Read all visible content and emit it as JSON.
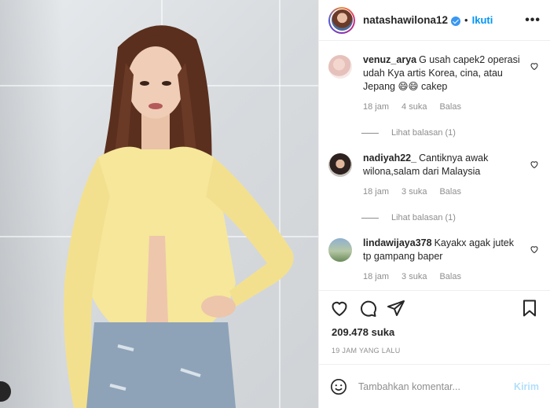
{
  "post_header": {
    "username": "natashawilona12",
    "separator": "•",
    "follow_label": "Ikuti",
    "more_label": "•••"
  },
  "comments": [
    {
      "username": "venuz_arya",
      "text": "G usah capek2 operasi udah Kya artis Korea, cina, atau Jepang 😄😄 cakep",
      "time": "18 jam",
      "likes": "4 suka",
      "reply_label": "Balas",
      "view_replies": "Lihat balasan (1)"
    },
    {
      "username": "nadiyah22_",
      "text": "Cantiknya awak wilona,salam dari Malaysia",
      "time": "18 jam",
      "likes": "3 suka",
      "reply_label": "Balas",
      "view_replies": "Lihat balasan (1)"
    },
    {
      "username": "lindawijaya378",
      "text": "Kayakx agak jutek tp gampang baper",
      "time": "18 jam",
      "likes": "3 suka",
      "reply_label": "Balas"
    }
  ],
  "actions": {
    "icons": [
      "heart-icon",
      "comment-icon",
      "share-icon",
      "bookmark-icon"
    ]
  },
  "likes_count": "209.478 suka",
  "posted_time": "19 JAM YANG LALU",
  "add_comment": {
    "placeholder": "Tambahkan komentar...",
    "send_label": "Kirim"
  },
  "colors": {
    "link": "#0095f6",
    "send_disabled": "#b2dffc",
    "muted": "#8e8e8e"
  }
}
